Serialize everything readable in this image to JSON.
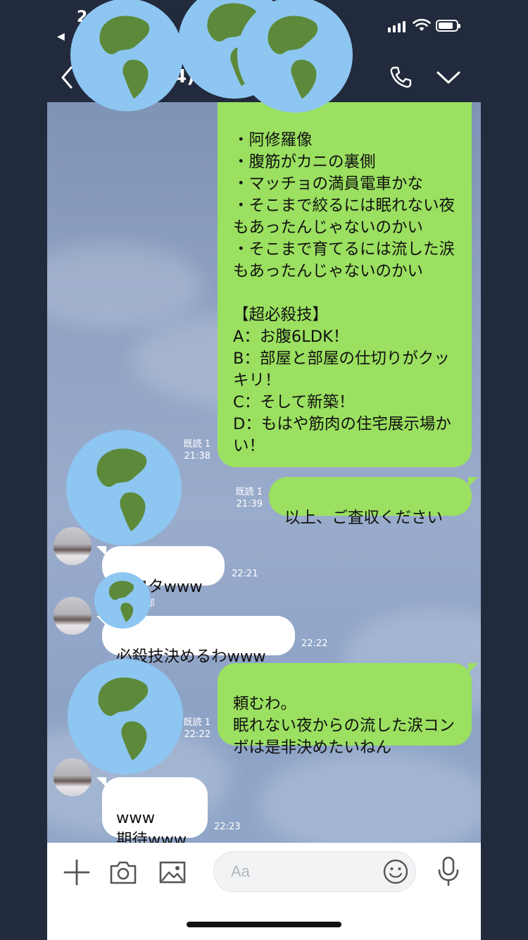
{
  "status_bar": {
    "time": "2",
    "back_app": "◀"
  },
  "header": {
    "title": "4)"
  },
  "messages": [
    {
      "id": "m1",
      "side": "me",
      "text": "・阿修羅像\n・腹筋がカニの裏側\n・マッチョの満員電車かな\n・そこまで絞るには眠れない夜もあったんじゃないのかい\n・そこまで育てるには流した涙もあったんじゃないのかい\n\n【超必殺技】\nA：お腹6LDK！\nB：部屋と部屋の仕切りがクッキリ！\nC：そして新築！\nD：もはや筋肉の住宅展示場かい！",
      "read": "既読 1",
      "time": "21:38"
    },
    {
      "id": "m2",
      "side": "me",
      "text": "以上、ご査収ください",
      "read": "既読 1",
      "time": "21:39"
    },
    {
      "id": "m3",
      "side": "them",
      "text": "ワロタwww",
      "time": "22:21"
    },
    {
      "id": "m4",
      "side": "them",
      "sender": "部",
      "text": "必殺技決めるわwww",
      "time": "22:22"
    },
    {
      "id": "m5",
      "side": "me",
      "text": "頼むわ。\n眠れない夜からの流した涙コンボは是非決めたいねん",
      "read": "既読 1",
      "time": "22:22"
    },
    {
      "id": "m6",
      "side": "them",
      "text": "www\n期待www",
      "time": "22:23"
    }
  ],
  "input": {
    "placeholder": "Aa"
  },
  "icons": {
    "plus": "plus-icon",
    "camera": "camera-icon",
    "image": "image-icon",
    "emoji": "emoji-icon",
    "mic": "microphone-icon",
    "back": "chevron-left-icon",
    "call": "phone-icon",
    "menu": "chevron-down-icon"
  },
  "colors": {
    "frame": "#222a3d",
    "bubble_me": "#9be060",
    "bubble_them": "#ffffff",
    "chat_bg": "#8fa2c3"
  }
}
